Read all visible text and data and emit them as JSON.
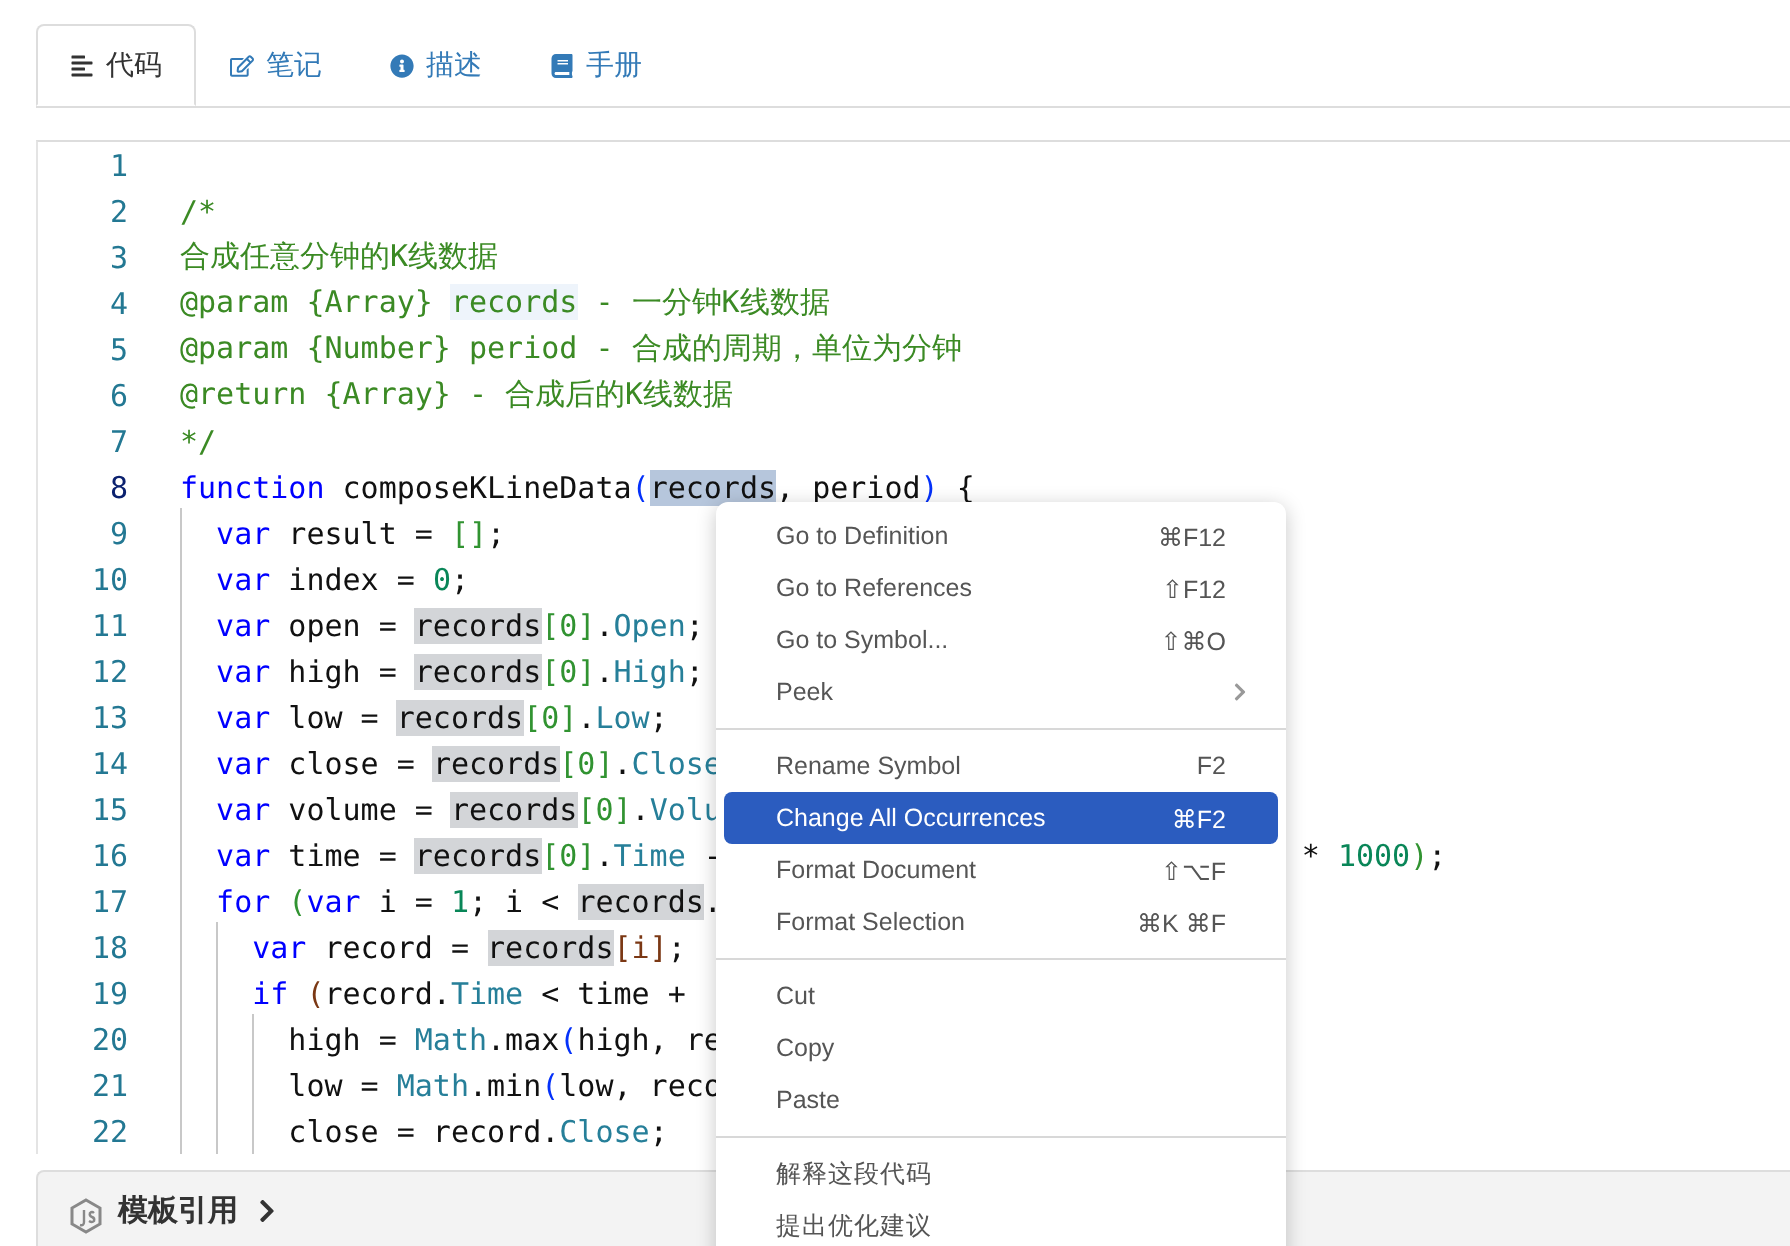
{
  "tabs": [
    {
      "label": "代码",
      "selected": true
    },
    {
      "label": "笔记",
      "selected": false
    },
    {
      "label": "描述",
      "selected": false
    },
    {
      "label": "手册",
      "selected": false
    }
  ],
  "editor": {
    "lines": [
      {
        "number": "1",
        "current": false
      },
      {
        "number": "2",
        "current": false,
        "tokens": [
          {
            "text": "/*",
            "kind": "comment"
          }
        ]
      },
      {
        "number": "3",
        "current": false,
        "tokens": [
          {
            "text": "合成任意分钟的K线数据",
            "kind": "comment"
          }
        ]
      },
      {
        "number": "4",
        "current": false,
        "tokens": [
          {
            "text": "@param {Array} ",
            "kind": "comment"
          },
          {
            "text": "records",
            "kind": "comment",
            "hinted": true
          },
          {
            "text": " - 一分钟K线数据",
            "kind": "comment"
          }
        ]
      },
      {
        "number": "5",
        "current": false,
        "tokens": [
          {
            "text": "@param {Number} period - 合成的周期，单位为分钟",
            "kind": "comment"
          }
        ]
      },
      {
        "number": "6",
        "current": false,
        "tokens": [
          {
            "text": "@return {Array} - 合成后的K线数据",
            "kind": "comment"
          }
        ]
      },
      {
        "number": "7",
        "current": false,
        "tokens": [
          {
            "text": "*/",
            "kind": "comment"
          }
        ]
      },
      {
        "number": "8",
        "current": true,
        "tokens": [
          {
            "text": "function",
            "kind": "keyword"
          },
          {
            "text": " composeKLineData",
            "kind": "plain"
          },
          {
            "text": "(",
            "kind": "paren-blue"
          },
          {
            "text": "records",
            "kind": "plain",
            "selected": true
          },
          {
            "text": ", period",
            "kind": "plain"
          },
          {
            "text": ")",
            "kind": "paren-blue"
          },
          {
            "text": " {",
            "kind": "plain"
          }
        ]
      },
      {
        "number": "9",
        "current": false,
        "tokens": [
          {
            "text": "  var",
            "kind": "keyword"
          },
          {
            "text": " result = ",
            "kind": "plain"
          },
          {
            "text": "[]",
            "kind": "paren-green"
          },
          {
            "text": ";",
            "kind": "plain"
          }
        ]
      },
      {
        "number": "10",
        "current": false,
        "tokens": [
          {
            "text": "  var",
            "kind": "keyword"
          },
          {
            "text": " index = ",
            "kind": "plain"
          },
          {
            "text": "0",
            "kind": "number"
          },
          {
            "text": ";",
            "kind": "plain"
          }
        ]
      },
      {
        "number": "11",
        "current": false,
        "tokens": [
          {
            "text": "  var",
            "kind": "keyword"
          },
          {
            "text": " open = ",
            "kind": "plain"
          },
          {
            "text": "records",
            "kind": "plain",
            "highlighted": true
          },
          {
            "text": "[0]",
            "kind": "paren-green"
          },
          {
            "text": ".",
            "kind": "plain"
          },
          {
            "text": "Open",
            "kind": "property"
          },
          {
            "text": ";",
            "kind": "plain"
          }
        ]
      },
      {
        "number": "12",
        "current": false,
        "tokens": [
          {
            "text": "  var",
            "kind": "keyword"
          },
          {
            "text": " high = ",
            "kind": "plain"
          },
          {
            "text": "records",
            "kind": "plain",
            "highlighted": true
          },
          {
            "text": "[0]",
            "kind": "paren-green"
          },
          {
            "text": ".",
            "kind": "plain"
          },
          {
            "text": "High",
            "kind": "property"
          },
          {
            "text": ";",
            "kind": "plain"
          }
        ]
      },
      {
        "number": "13",
        "current": false,
        "tokens": [
          {
            "text": "  var",
            "kind": "keyword"
          },
          {
            "text": " low = ",
            "kind": "plain"
          },
          {
            "text": "records",
            "kind": "plain",
            "highlighted": true
          },
          {
            "text": "[0]",
            "kind": "paren-green"
          },
          {
            "text": ".",
            "kind": "plain"
          },
          {
            "text": "Low",
            "kind": "property"
          },
          {
            "text": ";",
            "kind": "plain"
          }
        ]
      },
      {
        "number": "14",
        "current": false,
        "tokens": [
          {
            "text": "  var",
            "kind": "keyword"
          },
          {
            "text": " close = ",
            "kind": "plain"
          },
          {
            "text": "records",
            "kind": "plain",
            "highlighted": true
          },
          {
            "text": "[0]",
            "kind": "paren-green"
          },
          {
            "text": ".",
            "kind": "plain"
          },
          {
            "text": "Close",
            "kind": "property"
          }
        ]
      },
      {
        "number": "15",
        "current": false,
        "tokens": [
          {
            "text": "  var",
            "kind": "keyword"
          },
          {
            "text": " volume = ",
            "kind": "plain"
          },
          {
            "text": "records",
            "kind": "plain",
            "highlighted": true
          },
          {
            "text": "[0]",
            "kind": "paren-green"
          },
          {
            "text": ".",
            "kind": "plain"
          },
          {
            "text": "Volu",
            "kind": "property"
          }
        ]
      },
      {
        "number": "16",
        "current": false,
        "tokens": [
          {
            "text": "  var",
            "kind": "keyword"
          },
          {
            "text": " time = ",
            "kind": "plain"
          },
          {
            "text": "records",
            "kind": "plain",
            "highlighted": true
          },
          {
            "text": "[0]",
            "kind": "paren-green"
          },
          {
            "text": ".",
            "kind": "plain"
          },
          {
            "text": "Time",
            "kind": "property"
          },
          {
            "text": " -",
            "kind": "plain"
          }
        ],
        "tail": [
          {
            "text": "* ",
            "kind": "plain"
          },
          {
            "text": "1000",
            "kind": "number"
          },
          {
            "text": ")",
            "kind": "paren-green"
          },
          {
            "text": ";",
            "kind": "plain"
          }
        ]
      },
      {
        "number": "17",
        "current": false,
        "tokens": [
          {
            "text": "  for",
            "kind": "keyword"
          },
          {
            "text": " (",
            "kind": "paren-green"
          },
          {
            "text": "var",
            "kind": "keyword"
          },
          {
            "text": " i = ",
            "kind": "plain"
          },
          {
            "text": "1",
            "kind": "number"
          },
          {
            "text": "; i < ",
            "kind": "plain"
          },
          {
            "text": "records",
            "kind": "plain",
            "highlighted": true
          },
          {
            "text": ".",
            "kind": "plain"
          }
        ]
      },
      {
        "number": "18",
        "current": false,
        "tokens": [
          {
            "text": "    var",
            "kind": "keyword"
          },
          {
            "text": " record = ",
            "kind": "plain"
          },
          {
            "text": "records",
            "kind": "plain",
            "highlighted": true
          },
          {
            "text": "[i]",
            "kind": "paren-brown"
          },
          {
            "text": ";",
            "kind": "plain"
          }
        ]
      },
      {
        "number": "19",
        "current": false,
        "tokens": [
          {
            "text": "    if",
            "kind": "keyword"
          },
          {
            "text": " (",
            "kind": "paren-brown"
          },
          {
            "text": "record.",
            "kind": "plain"
          },
          {
            "text": "Time",
            "kind": "property"
          },
          {
            "text": " < time +",
            "kind": "plain"
          }
        ]
      },
      {
        "number": "20",
        "current": false,
        "tokens": [
          {
            "text": "      high = ",
            "kind": "plain"
          },
          {
            "text": "Math",
            "kind": "property"
          },
          {
            "text": ".max",
            "kind": "plain"
          },
          {
            "text": "(",
            "kind": "paren-blue"
          },
          {
            "text": "high, re",
            "kind": "plain"
          }
        ]
      },
      {
        "number": "21",
        "current": false,
        "tokens": [
          {
            "text": "      low = ",
            "kind": "plain"
          },
          {
            "text": "Math",
            "kind": "property"
          },
          {
            "text": ".min",
            "kind": "plain"
          },
          {
            "text": "(",
            "kind": "paren-blue"
          },
          {
            "text": "low, reco",
            "kind": "plain"
          }
        ]
      },
      {
        "number": "22",
        "current": false,
        "tokens": [
          {
            "text": "      close = record.",
            "kind": "plain"
          },
          {
            "text": "Close",
            "kind": "property"
          },
          {
            "text": ";",
            "kind": "plain"
          }
        ]
      }
    ]
  },
  "footer": {
    "label": "模板引用"
  },
  "context_menu": {
    "groups": [
      [
        {
          "label": "Go to Definition",
          "shortcut": "⌘F12",
          "selected": false,
          "submenu": false
        },
        {
          "label": "Go to References",
          "shortcut": "⇧F12",
          "selected": false,
          "submenu": false
        },
        {
          "label": "Go to Symbol...",
          "shortcut": "⇧⌘O",
          "selected": false,
          "submenu": false
        },
        {
          "label": "Peek",
          "selected": false,
          "submenu": true
        }
      ],
      [
        {
          "label": "Rename Symbol",
          "shortcut": "F2",
          "selected": false,
          "submenu": false
        },
        {
          "label": "Change All Occurrences",
          "shortcut": "⌘F2",
          "selected": true,
          "submenu": false
        },
        {
          "label": "Format Document",
          "shortcut": "⇧⌥F",
          "selected": false,
          "submenu": false
        },
        {
          "label": "Format Selection",
          "shortcut": "⌘K ⌘F",
          "selected": false,
          "submenu": false
        }
      ],
      [
        {
          "label": "Cut",
          "selected": false,
          "submenu": false
        },
        {
          "label": "Copy",
          "selected": false,
          "submenu": false
        },
        {
          "label": "Paste",
          "selected": false,
          "submenu": false
        }
      ],
      [
        {
          "label": "解释这段代码",
          "selected": false,
          "submenu": false
        },
        {
          "label": "提出优化建议",
          "selected": false,
          "submenu": false
        }
      ]
    ]
  }
}
